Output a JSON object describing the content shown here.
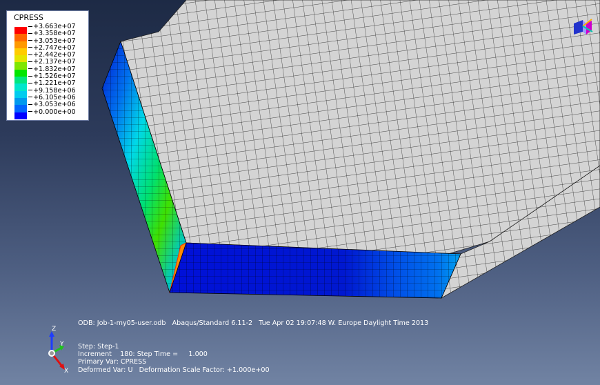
{
  "legend": {
    "title": "CPRESS",
    "colors": [
      "#ff0000",
      "#ff6600",
      "#ff9900",
      "#ffcc00",
      "#e5e500",
      "#80e600",
      "#00e600",
      "#00e680",
      "#00e6cc",
      "#00ccee",
      "#0099ee",
      "#0066ff",
      "#0000ff"
    ],
    "values": [
      "+3.663e+07",
      "+3.358e+07",
      "+3.053e+07",
      "+2.747e+07",
      "+2.442e+07",
      "+2.137e+07",
      "+1.832e+07",
      "+1.526e+07",
      "+1.221e+07",
      "+9.158e+06",
      "+6.105e+06",
      "+3.053e+06",
      "+0.000e+00"
    ]
  },
  "info": {
    "odb_line": "ODB: Job-1-my05-user.odb   Abaqus/Standard 6.11-2   Tue Apr 02 19:07:48 W. Europe Daylight Time 2013",
    "step_line": "Step: Step-1",
    "increment_line": "Increment    180: Step Time =     1.000",
    "primary_var_line": "Primary Var: CPRESS",
    "deformed_var_line": "Deformed Var: U   Deformation Scale Factor: +1.000e+00"
  },
  "triad": {
    "x_label": "X",
    "y_label": "Y",
    "z_label": "Z"
  },
  "colors": {
    "mesh_face": "#d4d4d4",
    "mesh_lines": "#1a1a1a",
    "background_top": "#1d2a45",
    "background_bottom": "#7183a3"
  }
}
